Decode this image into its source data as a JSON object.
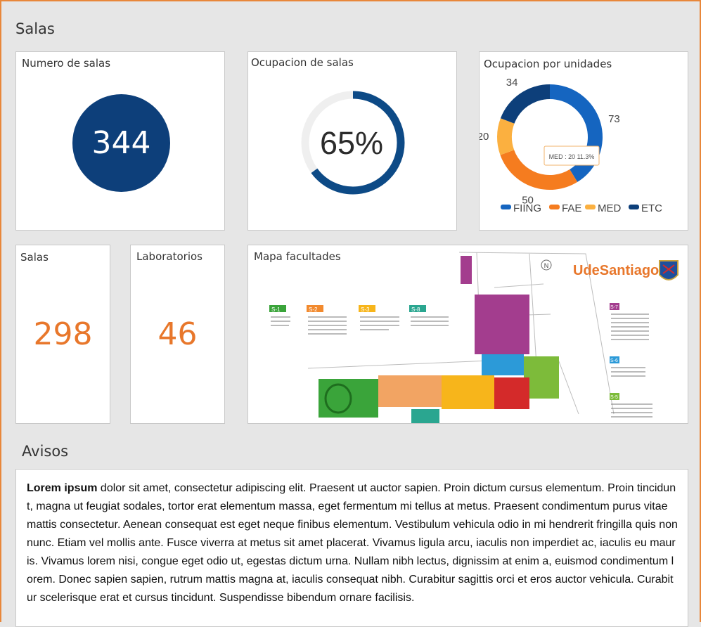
{
  "page": {
    "section_title": "Salas",
    "avisos_title": "Avisos"
  },
  "cards": {
    "numero_salas": {
      "title": "Numero de salas",
      "value": "344"
    },
    "ocupacion_salas": {
      "title": "Ocupacion de salas",
      "value": "65%",
      "percent": 65
    },
    "ocupacion_unidades": {
      "title": "Ocupacion por unidades",
      "tooltip": "MED : 20 11.3%"
    },
    "salas": {
      "title": "Salas",
      "value": "298"
    },
    "laboratorios": {
      "title": "Laboratorios",
      "value": "46"
    },
    "mapa": {
      "title": "Mapa facultades",
      "brand_ude": "Ude",
      "brand_santiago": "Santiago",
      "zones": [
        "S-1",
        "S-2",
        "S-3",
        "S-8",
        "S-7",
        "S-6",
        "S-5"
      ]
    }
  },
  "chart_data": {
    "type": "pie",
    "donut": true,
    "categories": [
      "FIING",
      "FAE",
      "MED",
      "ETC"
    ],
    "values": [
      73,
      50,
      20,
      34
    ],
    "colors": [
      "#1565c0",
      "#f57c1f",
      "#fbb040",
      "#0d3f7a"
    ],
    "legend_position": "bottom"
  },
  "avisos": {
    "bold": "Lorem ipsum",
    "text": " dolor sit amet, consectetur adipiscing elit. Praesent ut auctor sapien. Proin dictum cursus elementum. Proin tincidunt, magna ut feugiat sodales, tortor erat elementum massa, eget fermentum mi tellus at metus. Praesent condimentum purus vitae mattis consectetur. Aenean consequat est eget neque finibus elementum. Vestibulum vehicula odio in mi hendrerit fringilla quis non nunc. Etiam vel mollis ante. Fusce viverra at metus sit amet placerat. Vivamus ligula arcu, iaculis non imperdiet ac, iaculis eu mauris. Vivamus lorem nisi, congue eget odio ut, egestas dictum urna. Nullam nibh lectus, dignissim at enim a, euismod condimentum lorem. Donec sapien sapien, rutrum mattis magna at, iaculis consequat nibh. Curabitur sagittis orci et eros auctor vehicula. Curabitur scelerisque erat et cursus tincidunt. Suspendisse bibendum ornare facilisis."
  }
}
